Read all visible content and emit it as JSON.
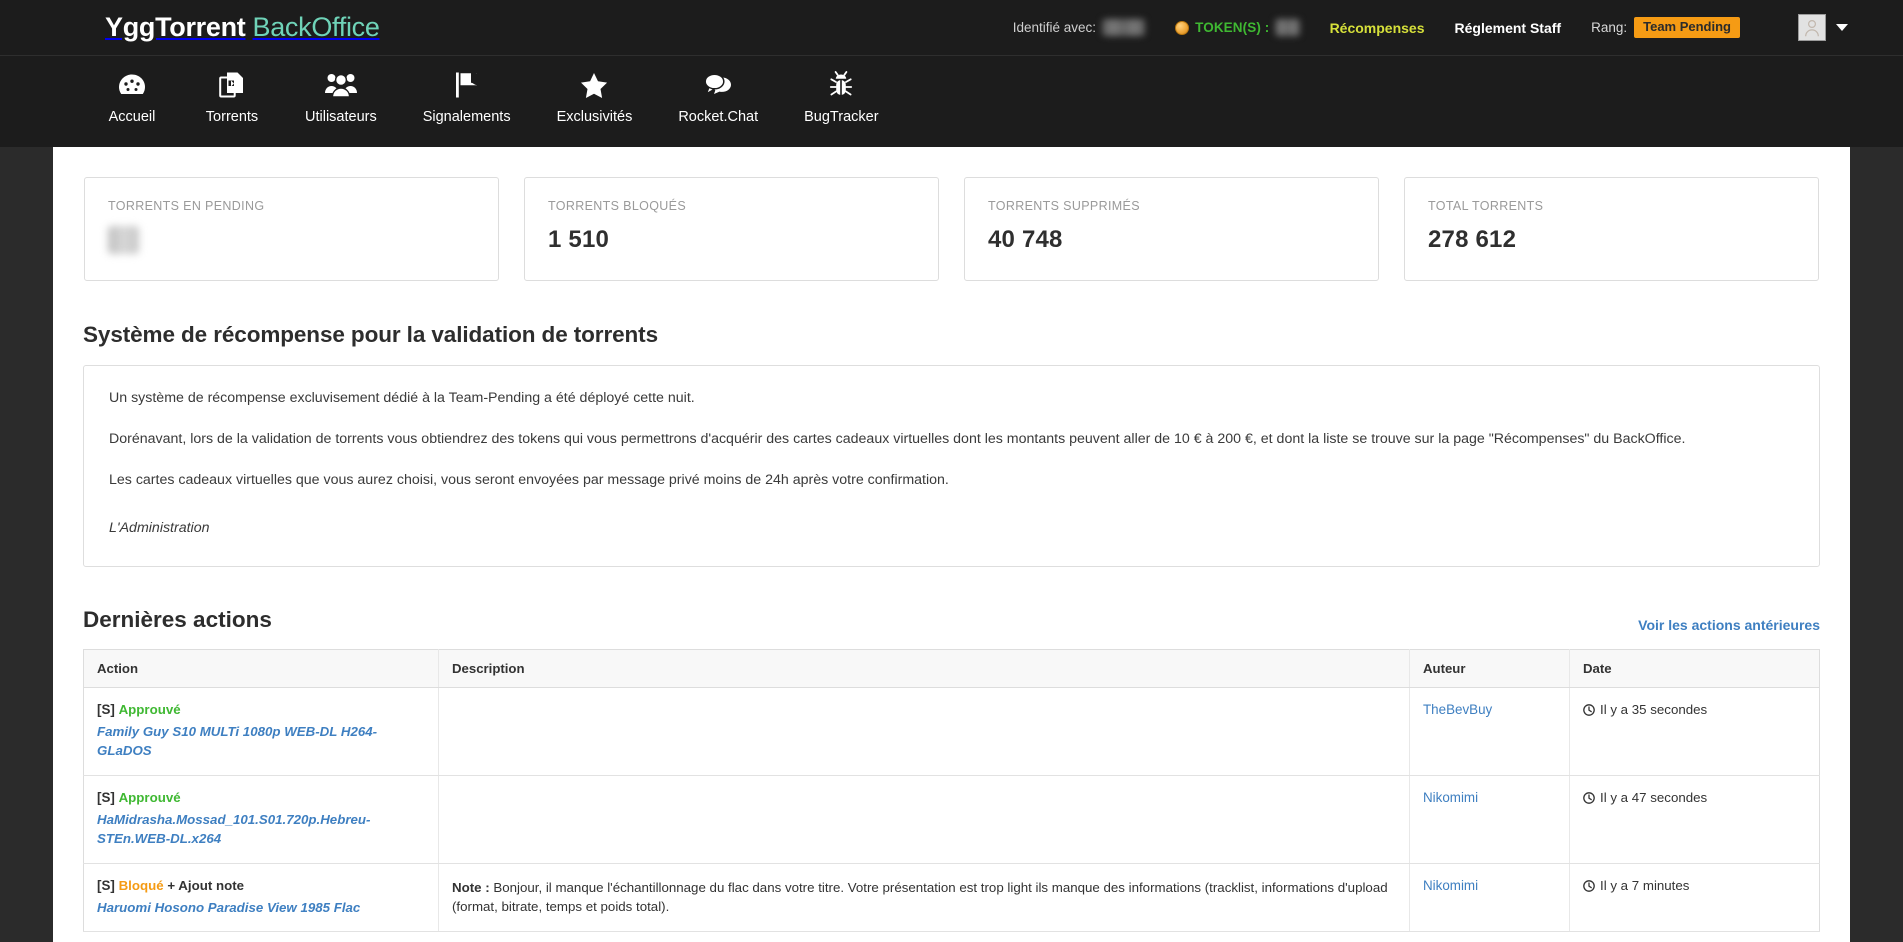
{
  "header": {
    "brand_main": "YggTorrent",
    "brand_sub": "BackOffice",
    "identified_label": "Identifié avec:",
    "identified_value": "•••••••",
    "token_label": "TOKEN(S) :",
    "token_value": "•••",
    "rewards_link": "Récompenses",
    "staff_rules_link": "Réglement Staff",
    "rank_label": "Rang:",
    "rank_badge": "Team Pending",
    "avatar_icon": "user-avatar-icon",
    "caret_icon": "chevron-down-icon",
    "colors": {
      "brand_accent": "#6fd3b8",
      "rewards": "#d6e03a",
      "rank_badge_bg": "#f59b14",
      "token_text": "#3fb832"
    }
  },
  "nav": {
    "items": [
      {
        "label": "Accueil",
        "icon": "dashboard-icon"
      },
      {
        "label": "Torrents",
        "icon": "files-icon"
      },
      {
        "label": "Utilisateurs",
        "icon": "users-icon"
      },
      {
        "label": "Signalements",
        "icon": "flag-icon"
      },
      {
        "label": "Exclusivités",
        "icon": "star-icon"
      },
      {
        "label": "Rocket.Chat",
        "icon": "chat-bubbles-icon"
      },
      {
        "label": "BugTracker",
        "icon": "bug-icon"
      }
    ]
  },
  "stats": [
    {
      "label": "TORRENTS EN PENDING",
      "value": "••",
      "hidden": true
    },
    {
      "label": "TORRENTS BLOQUÉS",
      "value": "1 510",
      "hidden": false
    },
    {
      "label": "TORRENTS SUPPRIMÉS",
      "value": "40 748",
      "hidden": false
    },
    {
      "label": "TOTAL TORRENTS",
      "value": "278 612",
      "hidden": false
    }
  ],
  "announcement": {
    "title": "Système de récompense pour la validation de torrents",
    "paragraphs": [
      "Un système de récompense excluvisement dédié à la Team-Pending a été déployé cette nuit.",
      "Dorénavant, lors de la validation de torrents vous obtiendrez des tokens qui vous permettrons d'acquérir des cartes cadeaux virtuelles dont les montants peuvent aller de 10 € à 200 €, et dont la liste se trouve sur la page \"Récompenses\" du BackOffice.",
      "Les cartes cadeaux virtuelles que vous aurez choisi, vous seront envoyées par message privé moins de 24h après votre confirmation."
    ],
    "signature": "L'Administration"
  },
  "latest_actions": {
    "title": "Dernières actions",
    "previous_link": "Voir les actions antérieures",
    "columns": [
      "Action",
      "Description",
      "Auteur",
      "Date"
    ],
    "rows": [
      {
        "prefix": "[S]",
        "state": "Approuvé",
        "state_color": "green",
        "extra": "",
        "title": "Family Guy S10 MULTi 1080p WEB-DL H264-GLaDOS",
        "description_label": "",
        "description": "",
        "auteur": "TheBevBuy",
        "date": "Il y a 35 secondes"
      },
      {
        "prefix": "[S]",
        "state": "Approuvé",
        "state_color": "green",
        "extra": "",
        "title": "HaMidrasha.Mossad_101.S01.720p.Hebreu-STEn.WEB-DL.x264",
        "description_label": "",
        "description": "",
        "auteur": "Nikomimi",
        "date": "Il y a 47 secondes"
      },
      {
        "prefix": "[S]",
        "state": "Bloqué",
        "state_color": "orange",
        "extra": "+ Ajout note",
        "title": "Haruomi Hosono Paradise View 1985 Flac",
        "description_label": "Note :",
        "description": " Bonjour, il manque l'échantillonnage du flac dans votre titre. Votre présentation est trop light ils manque des informations (tracklist, informations d'upload (format, bitrate, temps et poids total).",
        "auteur": "Nikomimi",
        "date": "Il y a 7 minutes"
      }
    ]
  }
}
